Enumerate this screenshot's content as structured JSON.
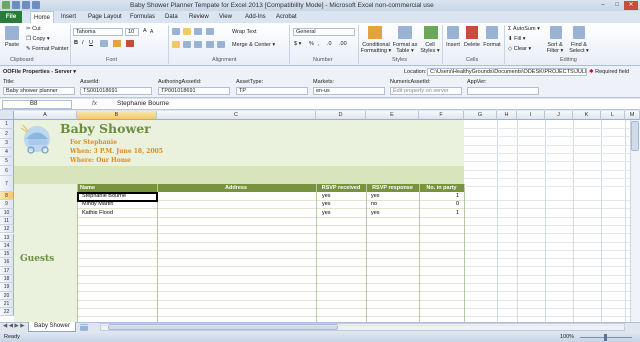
{
  "window": {
    "title": "Baby Shower Planner Tempate for Excel 2013  [Compatibility Mode]  -  Microsoft Excel non-commercial use",
    "min": "–",
    "max": "□",
    "close": "✕"
  },
  "tabs": [
    "File",
    "Home",
    "Insert",
    "Page Layout",
    "Formulas",
    "Data",
    "Review",
    "View",
    "Add-Ins",
    "Acrobat"
  ],
  "ribbon": {
    "clipboard": {
      "label": "Clipboard",
      "paste": "Paste",
      "cut": "Cut",
      "copy": "Copy ▾",
      "format_painter": "Format Painter"
    },
    "font": {
      "label": "Font",
      "name": "Tahoma",
      "size": "10",
      "bold": "B",
      "italic": "I",
      "underline": "U",
      "grow": "A",
      "shrink": "A"
    },
    "alignment": {
      "label": "Alignment",
      "wrap": "Wrap Text",
      "merge": "Merge & Center ▾"
    },
    "number": {
      "label": "Number",
      "format": "General",
      "currency": "$ ▾",
      "percent": "%",
      "comma": ",",
      "inc_dec": ".0",
      "dec_dec": ".00"
    },
    "styles": {
      "label": "Styles",
      "conditional": "Conditional Formatting ▾",
      "format_table": "Format as Table ▾",
      "cell_styles": "Cell Styles ▾"
    },
    "cells": {
      "label": "Cells",
      "insert": "Insert",
      "delete": "Delete",
      "format": "Format"
    },
    "editing": {
      "label": "Editing",
      "autosum": "AutoSum ▾",
      "fill": "Fill ▾",
      "clear": "Clear ▾",
      "sort": "Sort & Filter ▾",
      "find": "Find & Select ▾"
    }
  },
  "docinfo": {
    "panel_title": "OOFile Properties - Server ▾",
    "location_label": "Location:",
    "location_value": "C:\\Users\\HealthyGrounds\\Documents\\ODESK\\PROJECTS\\JULIAN MAG",
    "required": "Required field",
    "fields": [
      {
        "label": "Title:",
        "value": "Baby shower planner"
      },
      {
        "label": "AssetId:",
        "value": "TS001018691"
      },
      {
        "label": "AuthoringAssetId:",
        "value": "TP001018691"
      },
      {
        "label": "AssetType:",
        "value": "TP"
      },
      {
        "label": "Markets:",
        "value": "en-us"
      },
      {
        "label": "NumericAssetId:",
        "value": "Edit property on server"
      },
      {
        "label": "AppVer:",
        "value": ""
      }
    ]
  },
  "formula_bar": {
    "cell": "B8",
    "fx": "fx",
    "value": "Stephanie Bourne"
  },
  "columns": [
    "A",
    "B",
    "C",
    "D",
    "E",
    "F",
    "G",
    "H",
    "I",
    "J",
    "K",
    "L",
    "M"
  ],
  "rows": [
    "1",
    "2",
    "3",
    "4",
    "5",
    "6",
    "7",
    "8",
    "9",
    "10",
    "11",
    "12",
    "13",
    "14",
    "15",
    "16",
    "17",
    "18",
    "19",
    "20",
    "21",
    "22",
    "23",
    "24",
    "25"
  ],
  "sheet": {
    "title": "Baby Shower",
    "for_line": "For Stephanie",
    "when_line": "When:  3 P.M. June 18, 2005",
    "where_line": "Where:  Our Home",
    "guests_label": "Guests",
    "headers": {
      "name": "Name",
      "address": "Address",
      "rsvp_received": "RSVP received",
      "rsvp_response": "RSVP response",
      "in_party": "No. in party"
    },
    "guests": [
      {
        "name": "Stephanie Bourne",
        "received": "yes",
        "response": "yes",
        "count": "1"
      },
      {
        "name": "Mindy Martin",
        "received": "yes",
        "response": "no",
        "count": "0"
      },
      {
        "name": "Kathie Flood",
        "received": "yes",
        "response": "yes",
        "count": "1"
      }
    ]
  },
  "sheet_tabs": {
    "active": "Baby Shower"
  },
  "status": {
    "ready": "Ready",
    "zoom": "100%"
  }
}
